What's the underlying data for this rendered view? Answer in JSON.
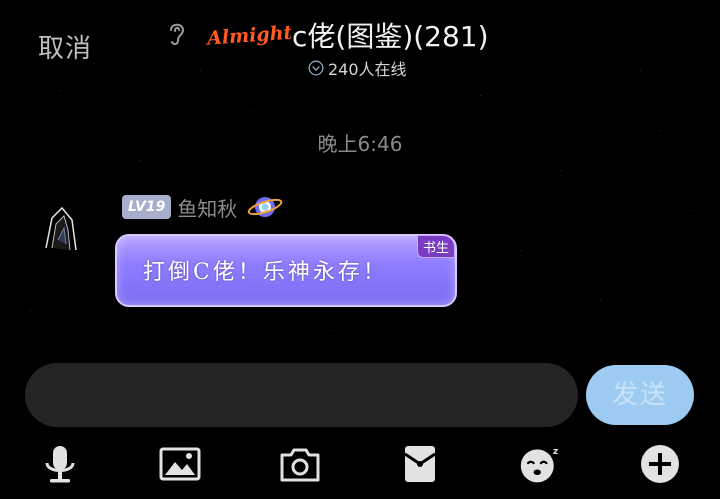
{
  "header": {
    "cancel_label": "取消",
    "logo_text": "Almighty",
    "title": "c佬(图鉴)(281)",
    "online_text": "240人在线"
  },
  "chat": {
    "timestamp": "晚上6:46",
    "message": {
      "level": "LV19",
      "sender": "鱼知秋",
      "text": "打倒C佬！乐神永存！",
      "tag": "书生"
    }
  },
  "input": {
    "send_label": "发送"
  },
  "toolbar": {
    "items": [
      "microphone-icon",
      "image-icon",
      "camera-icon",
      "red-packet-icon",
      "emoji-icon",
      "plus-icon"
    ]
  },
  "colors": {
    "send_button": "#9ecbf2",
    "bubble_start": "#b7a2ff",
    "bubble_end": "#7a6cf2",
    "logo": "#ff5a1f"
  }
}
